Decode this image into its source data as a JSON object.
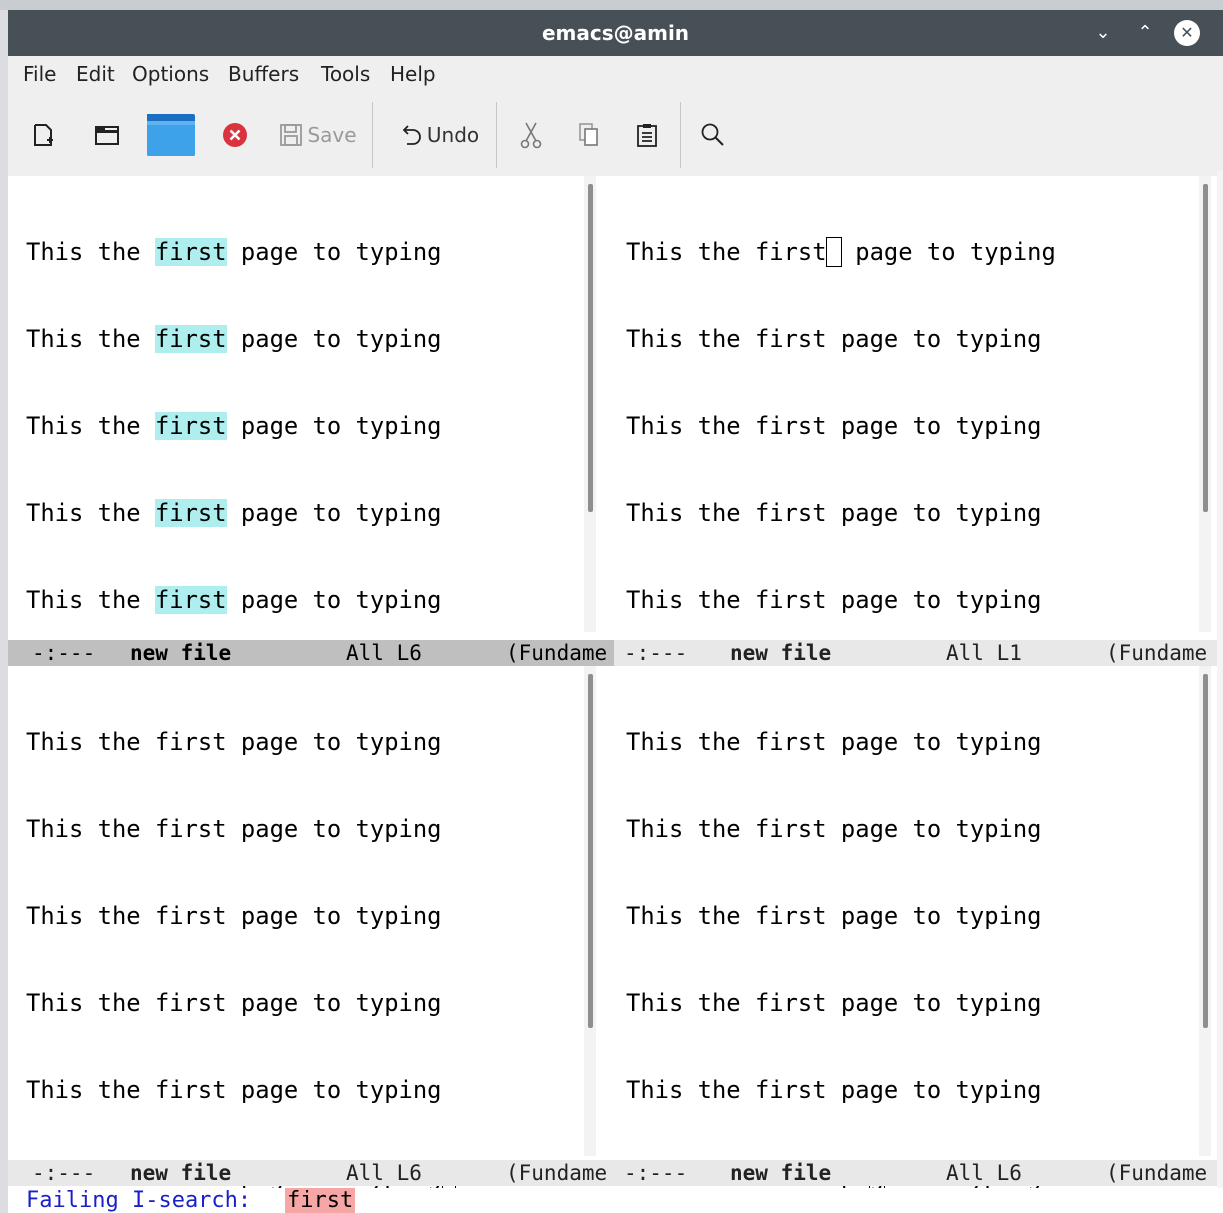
{
  "window": {
    "title": "emacs@amin"
  },
  "menu": [
    "File",
    "Edit",
    "Options",
    "Buffers",
    "Tools",
    "Help"
  ],
  "toolbar": {
    "save_label": "Save",
    "undo_label": "Undo",
    "icons": [
      "new-file-icon",
      "open-directory-icon",
      "folder-icon",
      "close-buffer-icon",
      "save-icon",
      "undo-icon",
      "cut-icon",
      "copy-icon",
      "paste-icon",
      "search-icon"
    ]
  },
  "buffer_line": {
    "w1": "This the ",
    "w2": "first",
    "w3": " page to typing",
    "w3a": " page to typing",
    "pa": "pa",
    "g": "g",
    "rest": "e to typing"
  },
  "panes": {
    "top_left": {
      "modeline": {
        "flags": "-:---",
        "name": "new file",
        "pos": "All L6",
        "mode": "(Fundame"
      }
    },
    "top_right": {
      "modeline": {
        "flags": "-:---",
        "name": "new file",
        "pos": "All L1",
        "mode": "(Fundame"
      }
    },
    "bottom_left": {
      "modeline": {
        "flags": "-:---",
        "name": "new file",
        "pos": "All L6",
        "mode": "(Fundame"
      }
    },
    "bottom_right": {
      "modeline": {
        "flags": "-:---",
        "name": "new file",
        "pos": "All L6",
        "mode": "(Fundame"
      }
    }
  },
  "echo_area": {
    "prompt": "Failing I-search: ",
    "term": "first"
  },
  "colors": {
    "titlebar": "#475057",
    "isearch_highlight": "#aeeeee",
    "failed_match": "#f7a6a6",
    "prompt": "#1a1fc9"
  }
}
